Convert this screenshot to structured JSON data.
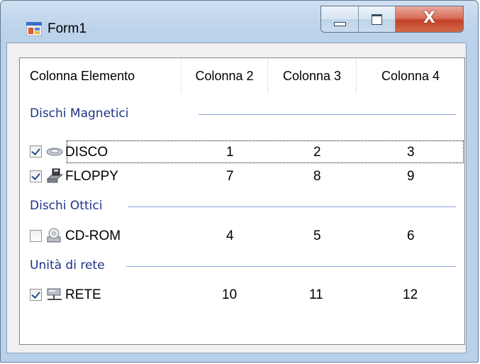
{
  "window": {
    "title": "Form1",
    "buttons": {
      "minimize": "minimize",
      "maximize": "maximize",
      "close": "X"
    }
  },
  "listview": {
    "columns": [
      "Colonna Elemento",
      "Colonna 2",
      "Colonna 3",
      "Colonna 4"
    ],
    "groups": [
      {
        "header": "Dischi Magnetici",
        "items": [
          {
            "name": "DISCO",
            "checked": true,
            "icon": "hard-disk-icon",
            "values": [
              "1",
              "2",
              "3"
            ]
          },
          {
            "name": "FLOPPY",
            "checked": true,
            "icon": "floppy-drive-icon",
            "values": [
              "7",
              "8",
              "9"
            ]
          }
        ]
      },
      {
        "header": "Dischi Ottici",
        "items": [
          {
            "name": "CD-ROM",
            "checked": false,
            "icon": "cdrom-drive-icon",
            "values": [
              "4",
              "5",
              "6"
            ]
          }
        ]
      },
      {
        "header": "Unità di rete",
        "items": [
          {
            "name": "RETE",
            "checked": true,
            "icon": "network-drive-icon",
            "values": [
              "10",
              "11",
              "12"
            ]
          }
        ]
      }
    ]
  },
  "colors": {
    "group_header": "#1e3287",
    "group_line": "#8aa7d6",
    "title_bar": "#b9d1ea",
    "close_button": "#c4412a"
  }
}
